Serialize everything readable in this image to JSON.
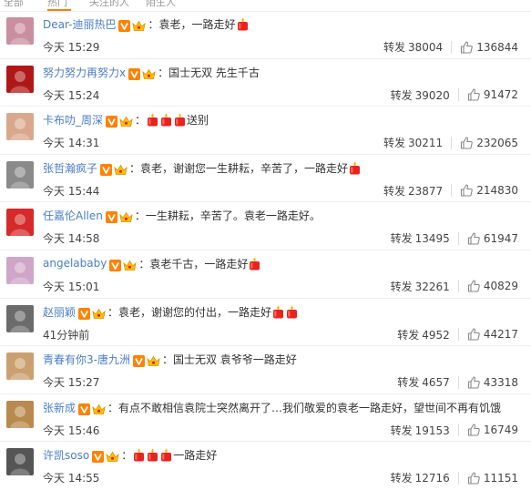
{
  "tabs": [
    "全部",
    "热门",
    "关注的人",
    "陌生人"
  ],
  "forward_label": "转发",
  "colors": {
    "nick": "#4a7ec6",
    "badge": "#ff8200",
    "text": "#333333"
  },
  "comments": [
    {
      "user": "Dear-迪丽热巴",
      "text_before": "：袁老，一路走好",
      "candles_mid": 0,
      "text_after": "",
      "candles_end": 1,
      "time": "今天 15:29",
      "forwards": "38004",
      "likes": "136844",
      "avatar_color": "#c98fa0"
    },
    {
      "user": "努力努力再努力x",
      "text_before": "：国士无双 先生千古",
      "candles_mid": 0,
      "text_after": "",
      "candles_end": 0,
      "time": "今天 15:24",
      "forwards": "39020",
      "likes": "91472",
      "avatar_color": "#b01818"
    },
    {
      "user": "卡布叻_周深",
      "text_before": "：",
      "candles_mid": 3,
      "text_after": "送别",
      "candles_end": 0,
      "time": "今天 14:31",
      "forwards": "30211",
      "likes": "232065",
      "avatar_color": "#d9a88c"
    },
    {
      "user": "张哲瀚疯子",
      "text_before": "：袁老，谢谢您一生耕耘，辛苦了，一路走好",
      "candles_mid": 0,
      "text_after": "",
      "candles_end": 1,
      "time": "今天 15:44",
      "forwards": "23877",
      "likes": "214830",
      "avatar_color": "#8a8a8a"
    },
    {
      "user": "任嘉伦Allen",
      "text_before": "：一生耕耘，辛苦了。袁老一路走好。",
      "candles_mid": 0,
      "text_after": "",
      "candles_end": 0,
      "time": "今天 14:58",
      "forwards": "13495",
      "likes": "61947",
      "avatar_color": "#d62a2a"
    },
    {
      "user": "angelababy",
      "text_before": "：袁老千古，一路走好",
      "candles_mid": 0,
      "text_after": "",
      "candles_end": 1,
      "time": "今天 15:01",
      "forwards": "32261",
      "likes": "40829",
      "avatar_color": "#cfa6c8"
    },
    {
      "user": "赵丽颖",
      "text_before": "：袁老，谢谢您的付出，一路走好",
      "candles_mid": 0,
      "text_after": "",
      "candles_end": 2,
      "time": "41分钟前",
      "forwards": "4952",
      "likes": "44217",
      "avatar_color": "#6b6b6b"
    },
    {
      "user": "青春有你3-唐九洲",
      "text_before": "：国士无双 袁爷爷一路走好",
      "candles_mid": 0,
      "text_after": "",
      "candles_end": 0,
      "time": "今天 15:27",
      "forwards": "4657",
      "likes": "43318",
      "avatar_color": "#caa070"
    },
    {
      "user": "张新成",
      "text_before": "：有点不敢相信袁院士突然离开了…我们敬爱的袁老一路走好，望世间不再有饥饿",
      "candles_mid": 0,
      "text_after": "",
      "candles_end": 0,
      "time": "今天 15:46",
      "forwards": "19153",
      "likes": "16749",
      "avatar_color": "#b98a4e"
    },
    {
      "user": "许凯soso",
      "text_before": "：",
      "candles_mid": 3,
      "text_after": "一路走好",
      "candles_end": 0,
      "time": "今天 14:55",
      "forwards": "12716",
      "likes": "11151",
      "avatar_color": "#555555"
    }
  ]
}
